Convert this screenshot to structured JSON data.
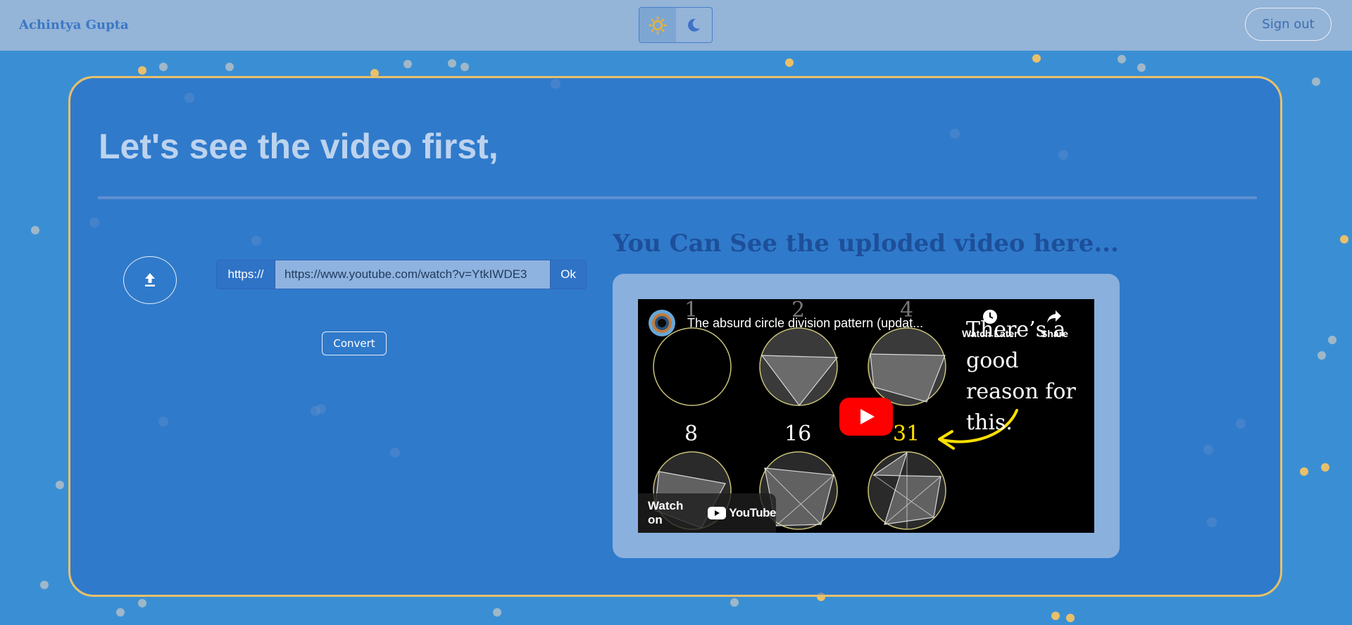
{
  "header": {
    "brand": "Achintya Gupta",
    "signout_label": "Sign out",
    "theme": {
      "options": [
        "light",
        "dark"
      ],
      "active": "light"
    }
  },
  "main": {
    "title": "Let's see the video first,",
    "url": {
      "prefix": "https://",
      "value": "https://www.youtube.com/watch?v=YtkIWDE3",
      "ok_label": "Ok"
    },
    "convert_label": "Convert",
    "uploaded_heading": "You Can See the uploded video here..."
  },
  "video": {
    "title": "The absurd circle division pattern (updat...",
    "watch_later_label": "Watch Later",
    "share_label": "Share",
    "watch_on_label": "Watch on",
    "youtube_label": "YouTube",
    "thumbnail_text": "There’s a good reason for this.",
    "numbers": [
      "1",
      "2",
      "4",
      "8",
      "16",
      "31"
    ]
  },
  "colors": {
    "background": "#3a8fd4",
    "header": "#94b4d8",
    "card_border": "#e8c06a",
    "accent": "#2f73c6"
  }
}
